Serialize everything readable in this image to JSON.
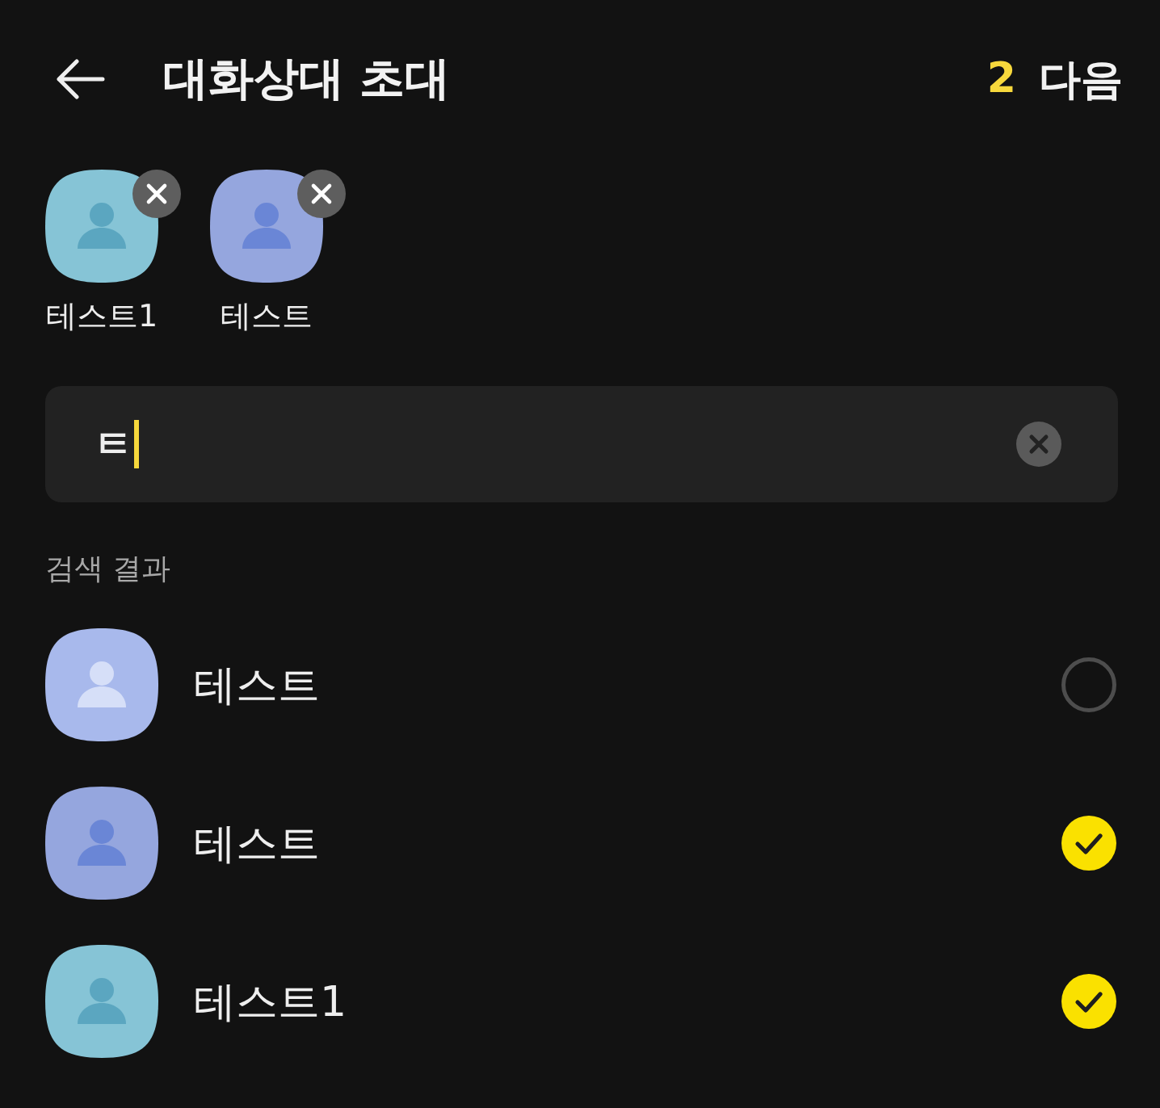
{
  "header": {
    "title": "대화상대 초대",
    "count": "2",
    "action": "다음"
  },
  "selected_contacts": [
    {
      "name": "테스트1",
      "avatar": {
        "color": "#86c4d6",
        "figure": {
          "color": "#5ba6c0"
        }
      }
    },
    {
      "name": "테스트",
      "avatar": {
        "color": "#95a6de",
        "figure": {
          "color": "#6a86d6"
        }
      }
    }
  ],
  "search": {
    "value": "ㅌ",
    "focused": true
  },
  "results_label": "검색 결과",
  "results": [
    {
      "name": "테스트",
      "selected": false,
      "avatar": {
        "color": "#a8b9ec",
        "figure": {
          "color": "#d6dff8"
        }
      }
    },
    {
      "name": "테스트",
      "selected": true,
      "avatar": {
        "color": "#95a6de",
        "figure": {
          "color": "#6a86d6"
        }
      }
    },
    {
      "name": "테스트1",
      "selected": true,
      "avatar": {
        "color": "#86c4d6",
        "figure": {
          "color": "#5ba6c0"
        }
      }
    }
  ]
}
